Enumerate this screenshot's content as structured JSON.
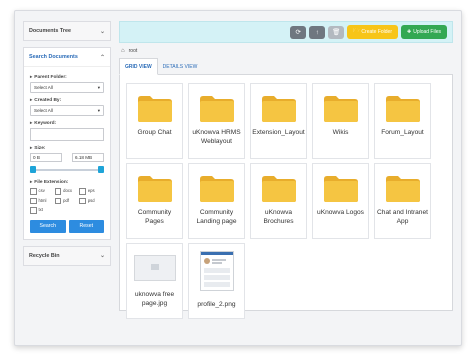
{
  "sidebar": {
    "documents_tree": "Documents Tree",
    "search_documents": "Search Documents",
    "parent_folder_label": "Parent Folder:",
    "parent_folder_value": "Select All",
    "created_by_label": "Created By:",
    "created_by_value": "Select All",
    "keyword_label": "Keyword:",
    "keyword_value": "",
    "size_label": "Size:",
    "size_min": "0 B",
    "size_max": "6.18 MB",
    "file_extension_label": "File Extension:",
    "extensions": [
      "csv",
      "docx",
      "eps",
      "html",
      "pdf",
      "psd",
      "txt"
    ],
    "search_button": "Search",
    "reset_button": "Reset",
    "recycle_bin": "Recycle Bin"
  },
  "toolbar": {
    "create_folder": "Create Folder",
    "upload_files": "Upload Files"
  },
  "breadcrumb": {
    "root": "root"
  },
  "tabs": [
    "GRID VIEW",
    "DETAILS VIEW"
  ],
  "items": [
    {
      "name": "Group Chat",
      "type": "folder"
    },
    {
      "name": "uKnowva HRMS Weblayout",
      "type": "folder"
    },
    {
      "name": "Extension_Layout",
      "type": "folder"
    },
    {
      "name": "Wikis",
      "type": "folder"
    },
    {
      "name": "Forum_Layout",
      "type": "folder"
    },
    {
      "name": "Community Pages",
      "type": "folder"
    },
    {
      "name": "Community Landing page",
      "type": "folder"
    },
    {
      "name": "uKnowva Brochures",
      "type": "folder"
    },
    {
      "name": "uKnowva Logos",
      "type": "folder"
    },
    {
      "name": "Chat and Intranet App",
      "type": "folder"
    },
    {
      "name": "uknowva free page.jpg",
      "type": "image"
    },
    {
      "name": "profile_2.png",
      "type": "image"
    }
  ],
  "colors": {
    "toolbar_bg": "#d4f2f6",
    "create_folder": "#f7c518",
    "upload_files": "#33a853",
    "primary": "#2d8ce0",
    "folder": "#f5c542"
  }
}
